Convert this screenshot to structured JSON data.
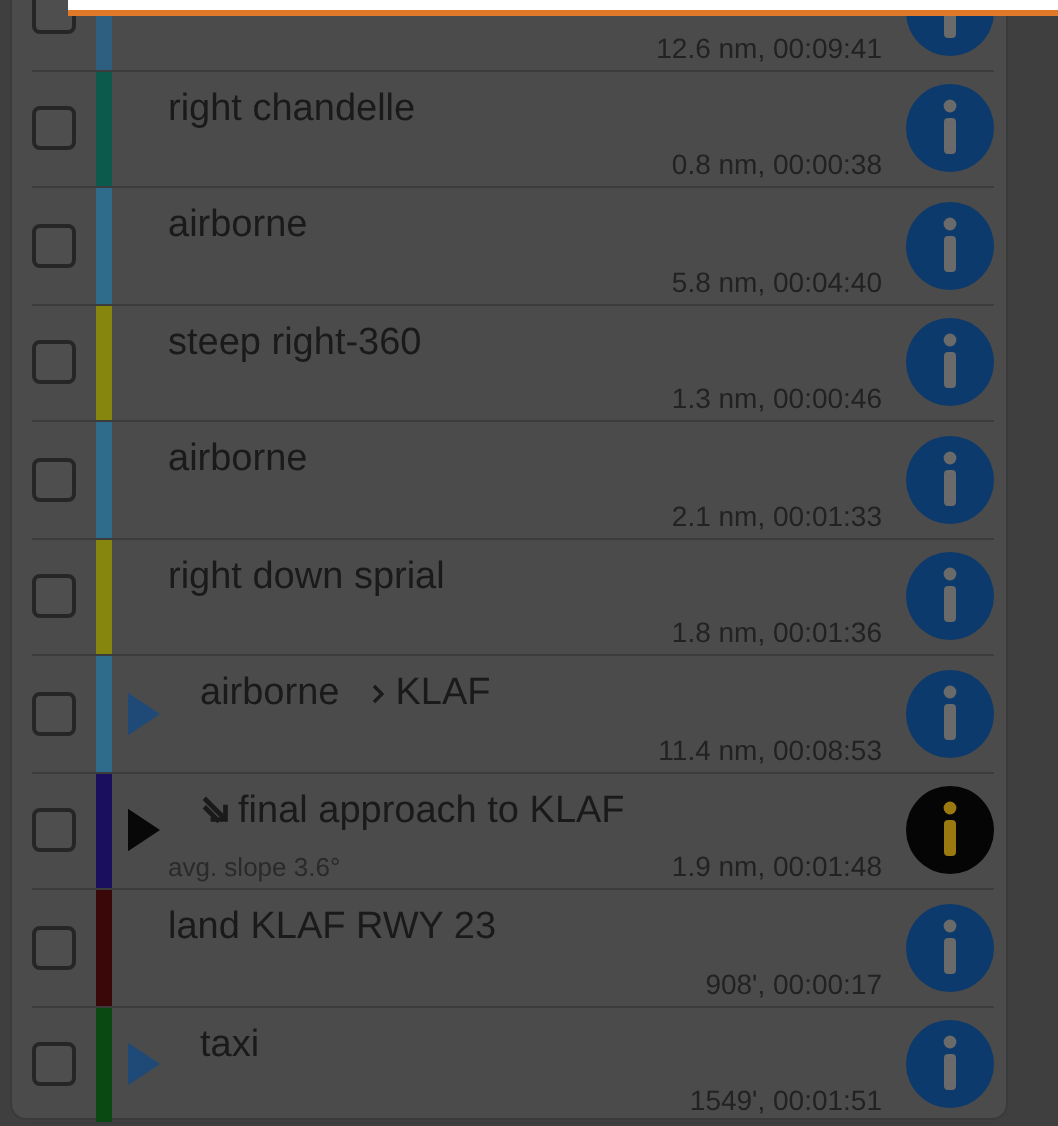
{
  "segments": [
    {
      "kind": "segment",
      "stats": "12.6 nm, 00:09:41",
      "color": "#2f5f80",
      "expandable": false,
      "selected": false,
      "checked": false
    },
    {
      "kind": "segment",
      "title": "right chandelle",
      "stats": "0.8 nm, 00:00:38",
      "color": "#0c5a4c",
      "expandable": false,
      "selected": false,
      "checked": false
    },
    {
      "kind": "segment",
      "title": "airborne",
      "stats": "5.8 nm, 00:04:40",
      "color": "#2f6b8a",
      "expandable": false,
      "selected": false,
      "checked": false
    },
    {
      "kind": "segment",
      "title": "steep right-360",
      "stats": "1.3 nm, 00:00:46",
      "color": "#86860e",
      "expandable": false,
      "selected": false,
      "checked": false
    },
    {
      "kind": "segment",
      "title": "airborne",
      "stats": "2.1 nm, 00:01:33",
      "color": "#2f6b8a",
      "expandable": false,
      "selected": false,
      "checked": false
    },
    {
      "kind": "segment",
      "title": "right down sprial",
      "stats": "1.8 nm, 00:01:36",
      "color": "#86860e",
      "expandable": false,
      "selected": false,
      "checked": false
    },
    {
      "kind": "segment",
      "title": "airborne",
      "destination": "KLAF",
      "stats": "11.4 nm, 00:08:53",
      "color": "#2f6b8a",
      "expandable": true,
      "selected": false,
      "checked": false
    },
    {
      "kind": "descent",
      "title": "final approach to KLAF",
      "subtitle": "avg. slope 3.6°",
      "stats": "1.9 nm, 00:01:48",
      "color": "#1a0e5e",
      "expandable": true,
      "selected": true,
      "checked": false
    },
    {
      "kind": "segment",
      "title": "land KLAF RWY 23",
      "stats": "908', 00:00:17",
      "color": "#3a0808",
      "expandable": false,
      "selected": false,
      "checked": false
    },
    {
      "kind": "segment",
      "title": "taxi",
      "stats": "1549', 00:01:51",
      "color": "#0a4a12",
      "expandable": true,
      "selected": false,
      "checked": false
    }
  ]
}
